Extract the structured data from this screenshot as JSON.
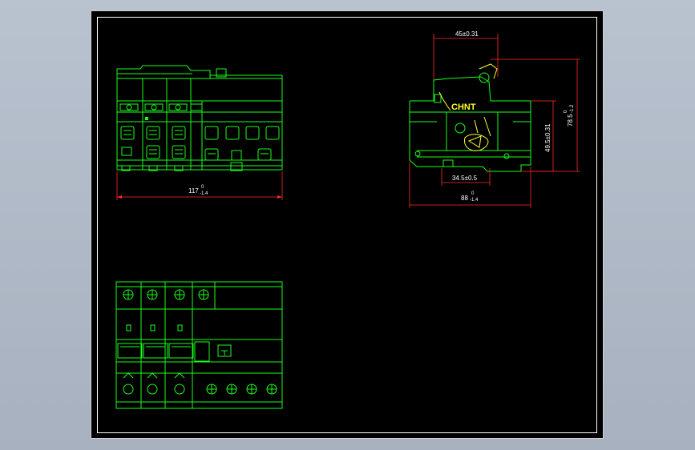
{
  "drawing": {
    "line_color": "#18ff18",
    "dimension_color": "#ff2a2a",
    "highlight_color": "#ffff2a",
    "background": "#000000",
    "brand_text": "CHNT",
    "dims": {
      "front_width": "117",
      "front_width_tol_upper": "0",
      "front_width_tol_lower": "-1.4",
      "side_top": "45±0.31",
      "side_bottom_inner": "34.5±0.5",
      "side_width": "88",
      "side_width_tol_upper": "0",
      "side_width_tol_lower": "-1.4",
      "side_height_inner": "49.5±0.31",
      "side_height": "78.5",
      "side_height_tol_upper": "0",
      "side_height_tol_lower": "-1.2"
    }
  }
}
